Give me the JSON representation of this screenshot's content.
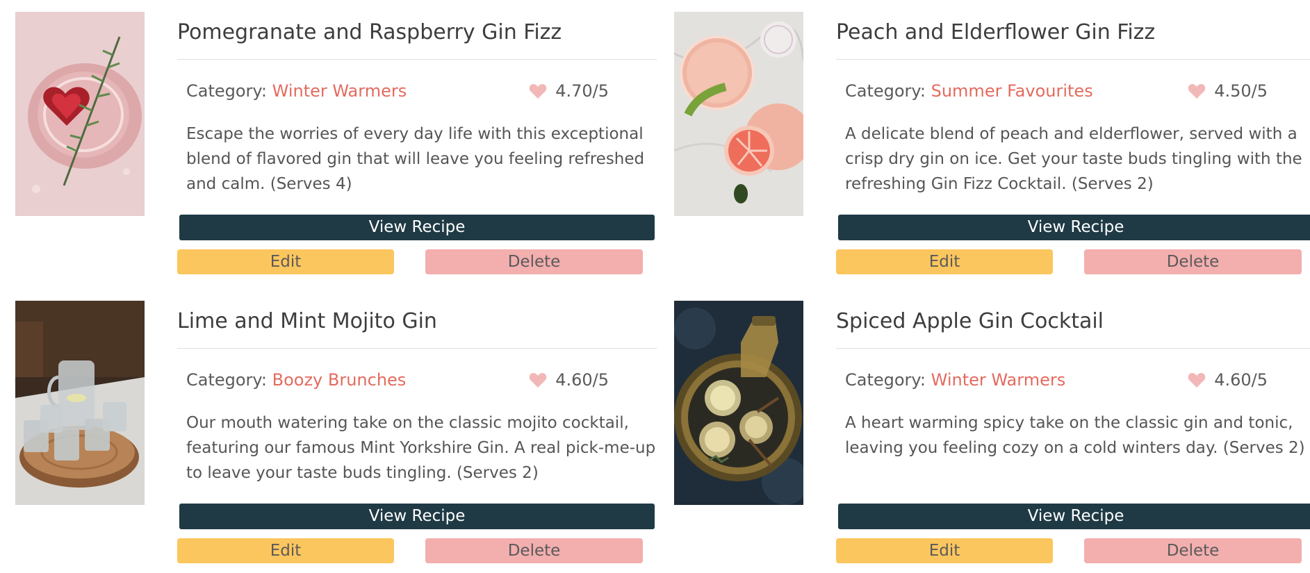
{
  "recipes": [
    {
      "title": "Pomegranate and Raspberry Gin Fizz",
      "category_label": "Category: ",
      "category": "Winter Warmers",
      "rating": "4.70/5",
      "description": "Escape the worries of every day life with this exceptional blend of flavored gin that will leave you feeling refreshed and calm. (Serves 4)",
      "image_icon": "pomegranate-gin-photo",
      "view_label": "View Recipe",
      "edit_label": "Edit",
      "delete_label": "Delete"
    },
    {
      "title": "Peach and Elderflower Gin Fizz",
      "category_label": "Category: ",
      "category": "Summer Favourites",
      "rating": "4.50/5",
      "description": "A delicate blend of peach and elderflower, served with a crisp dry gin on ice. Get your taste buds tingling with the refreshing Gin Fizz Cocktail. (Serves 2)",
      "image_icon": "peach-gin-photo",
      "view_label": "View Recipe",
      "edit_label": "Edit",
      "delete_label": "Delete"
    },
    {
      "title": "Lime and Mint Mojito Gin",
      "category_label": "Category: ",
      "category": "Boozy Brunches",
      "rating": "4.60/5",
      "description": "Our mouth watering take on the classic mojito cocktail, featuring our famous Mint Yorkshire Gin. A real pick-me-up to leave your taste buds tingling. (Serves 2)",
      "image_icon": "mojito-glasses-photo",
      "view_label": "View Recipe",
      "edit_label": "Edit",
      "delete_label": "Delete"
    },
    {
      "title": "Spiced Apple Gin Cocktail",
      "category_label": "Category: ",
      "category": "Winter Warmers",
      "rating": "4.60/5",
      "description": "A heart warming spicy take on the classic gin and tonic, leaving you feeling cozy on a cold winters day. (Serves 2)",
      "image_icon": "spiced-apple-photo",
      "view_label": "View Recipe",
      "edit_label": "Edit",
      "delete_label": "Delete"
    }
  ],
  "colors": {
    "view_button": "#1f3a45",
    "edit_button": "#fcc65e",
    "delete_button": "#f3aeae",
    "category_accent": "#e36b5f",
    "heart": "#f2b8b8"
  },
  "icons": {
    "rating": "heart-icon"
  }
}
